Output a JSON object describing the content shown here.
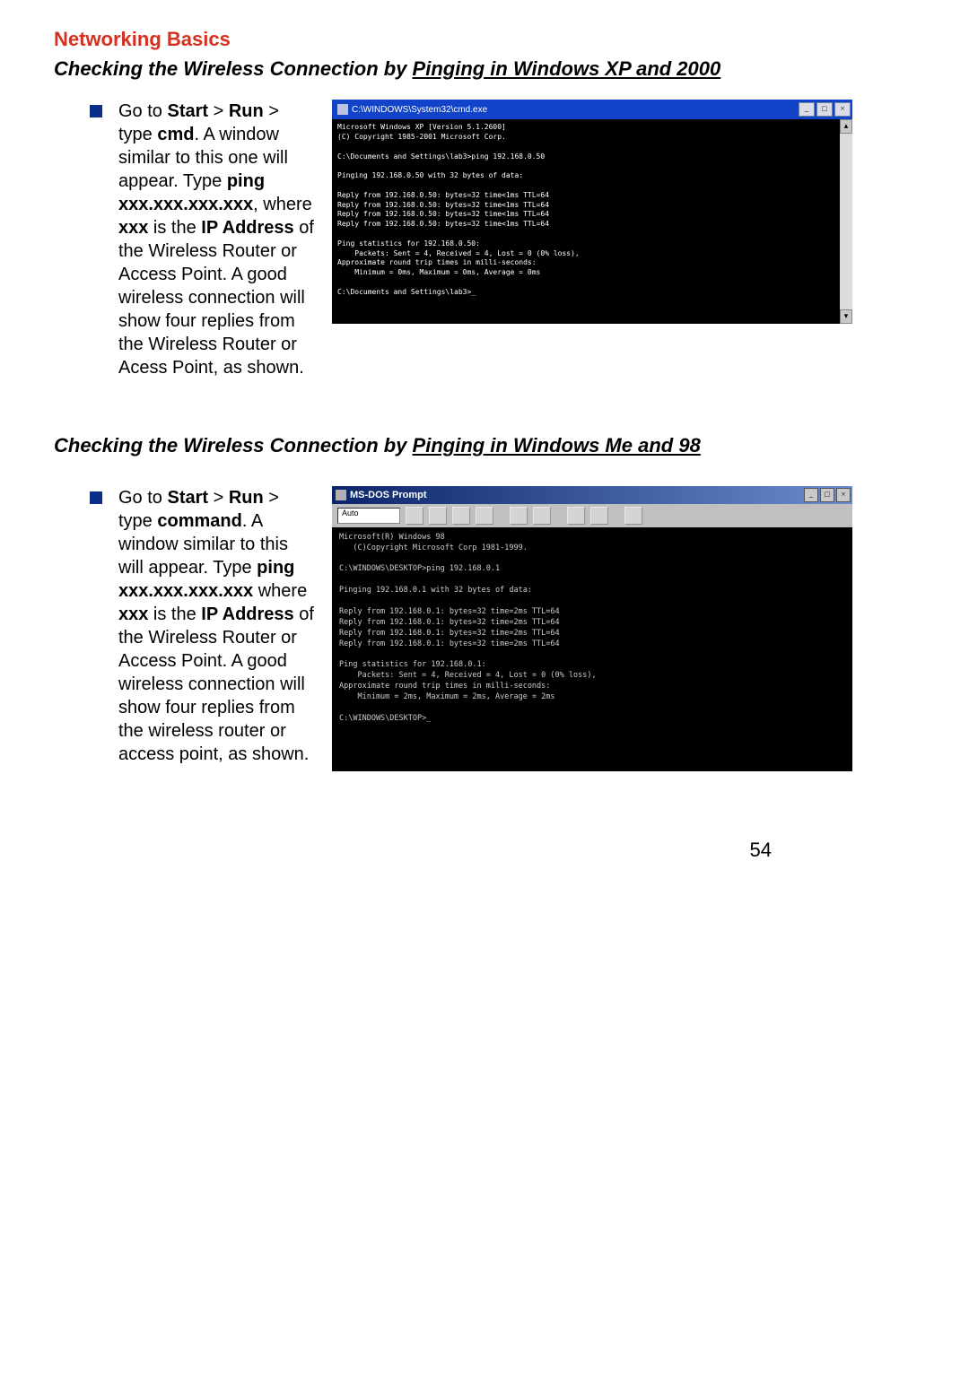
{
  "page": {
    "title": "Networking Basics",
    "pageNumber": "54"
  },
  "section1": {
    "heading_prefix": "Checking the Wireless Connection by ",
    "heading_uline": "Pinging in Windows XP and 2000",
    "para_parts": [
      {
        "t": "Go to ",
        "b": false
      },
      {
        "t": "Start",
        "b": true
      },
      {
        "t": " > ",
        "b": false
      },
      {
        "t": "Run",
        "b": true
      },
      {
        "t": " > type ",
        "b": false
      },
      {
        "t": "cmd",
        "b": true
      },
      {
        "t": ".  A window similar to this one will appear.  Type ",
        "b": false
      },
      {
        "t": "ping xxx.xxx.xxx.xxx",
        "b": true
      },
      {
        "t": ", where ",
        "b": false
      },
      {
        "t": "xxx",
        "b": true
      },
      {
        "t": " is the ",
        "b": false
      },
      {
        "t": "IP Address",
        "b": true
      },
      {
        "t": " of the Wireless Router or Access Point.  A good wireless connection will show four replies from the Wireless Router or Acess Point, as shown.",
        "b": false
      }
    ],
    "cmd_title": "C:\\WINDOWS\\System32\\cmd.exe",
    "cmd_output": "Microsoft Windows XP [Version 5.1.2600]\n(C) Copyright 1985-2001 Microsoft Corp.\n\nC:\\Documents and Settings\\lab3>ping 192.168.0.50\n\nPinging 192.168.0.50 with 32 bytes of data:\n\nReply from 192.168.0.50: bytes=32 time<1ms TTL=64\nReply from 192.168.0.50: bytes=32 time<1ms TTL=64\nReply from 192.168.0.50: bytes=32 time<1ms TTL=64\nReply from 192.168.0.50: bytes=32 time<1ms TTL=64\n\nPing statistics for 192.168.0.50:\n    Packets: Sent = 4, Received = 4, Lost = 0 (0% loss),\nApproximate round trip times in milli-seconds:\n    Minimum = 0ms, Maximum = 0ms, Average = 0ms\n\nC:\\Documents and Settings\\lab3>_"
  },
  "section2": {
    "heading_prefix": "Checking the Wireless Connection by ",
    "heading_uline": "Pinging in Windows Me and 98",
    "para_parts": [
      {
        "t": "Go to ",
        "b": false
      },
      {
        "t": "Start",
        "b": true
      },
      {
        "t": " > ",
        "b": false
      },
      {
        "t": "Run",
        "b": true
      },
      {
        "t": " > type ",
        "b": false
      },
      {
        "t": "command",
        "b": true
      },
      {
        "t": ".  A window similar to this will appear.  Type ",
        "b": false
      },
      {
        "t": "ping xxx.xxx.xxx.xxx",
        "b": true
      },
      {
        "t": " where ",
        "b": false
      },
      {
        "t": "xxx",
        "b": true
      },
      {
        "t": " is the ",
        "b": false
      },
      {
        "t": "IP Address",
        "b": true
      },
      {
        "t": " of the Wireless Router or Access Point.  A good wireless connection will show four replies from the wireless router or access point, as shown.",
        "b": false
      }
    ],
    "cmd_title": "MS-DOS Prompt",
    "toolbar_label": "Auto",
    "cmd_output": "Microsoft(R) Windows 98\n   (C)Copyright Microsoft Corp 1981-1999.\n\nC:\\WINDOWS\\DESKTOP>ping 192.168.0.1\n\nPinging 192.168.0.1 with 32 bytes of data:\n\nReply from 192.168.0.1: bytes=32 time=2ms TTL=64\nReply from 192.168.0.1: bytes=32 time=2ms TTL=64\nReply from 192.168.0.1: bytes=32 time=2ms TTL=64\nReply from 192.168.0.1: bytes=32 time=2ms TTL=64\n\nPing statistics for 192.168.0.1:\n    Packets: Sent = 4, Received = 4, Lost = 0 (0% loss),\nApproximate round trip times in milli-seconds:\n    Minimum = 2ms, Maximum = 2ms, Average = 2ms\n\nC:\\WINDOWS\\DESKTOP>_"
  }
}
